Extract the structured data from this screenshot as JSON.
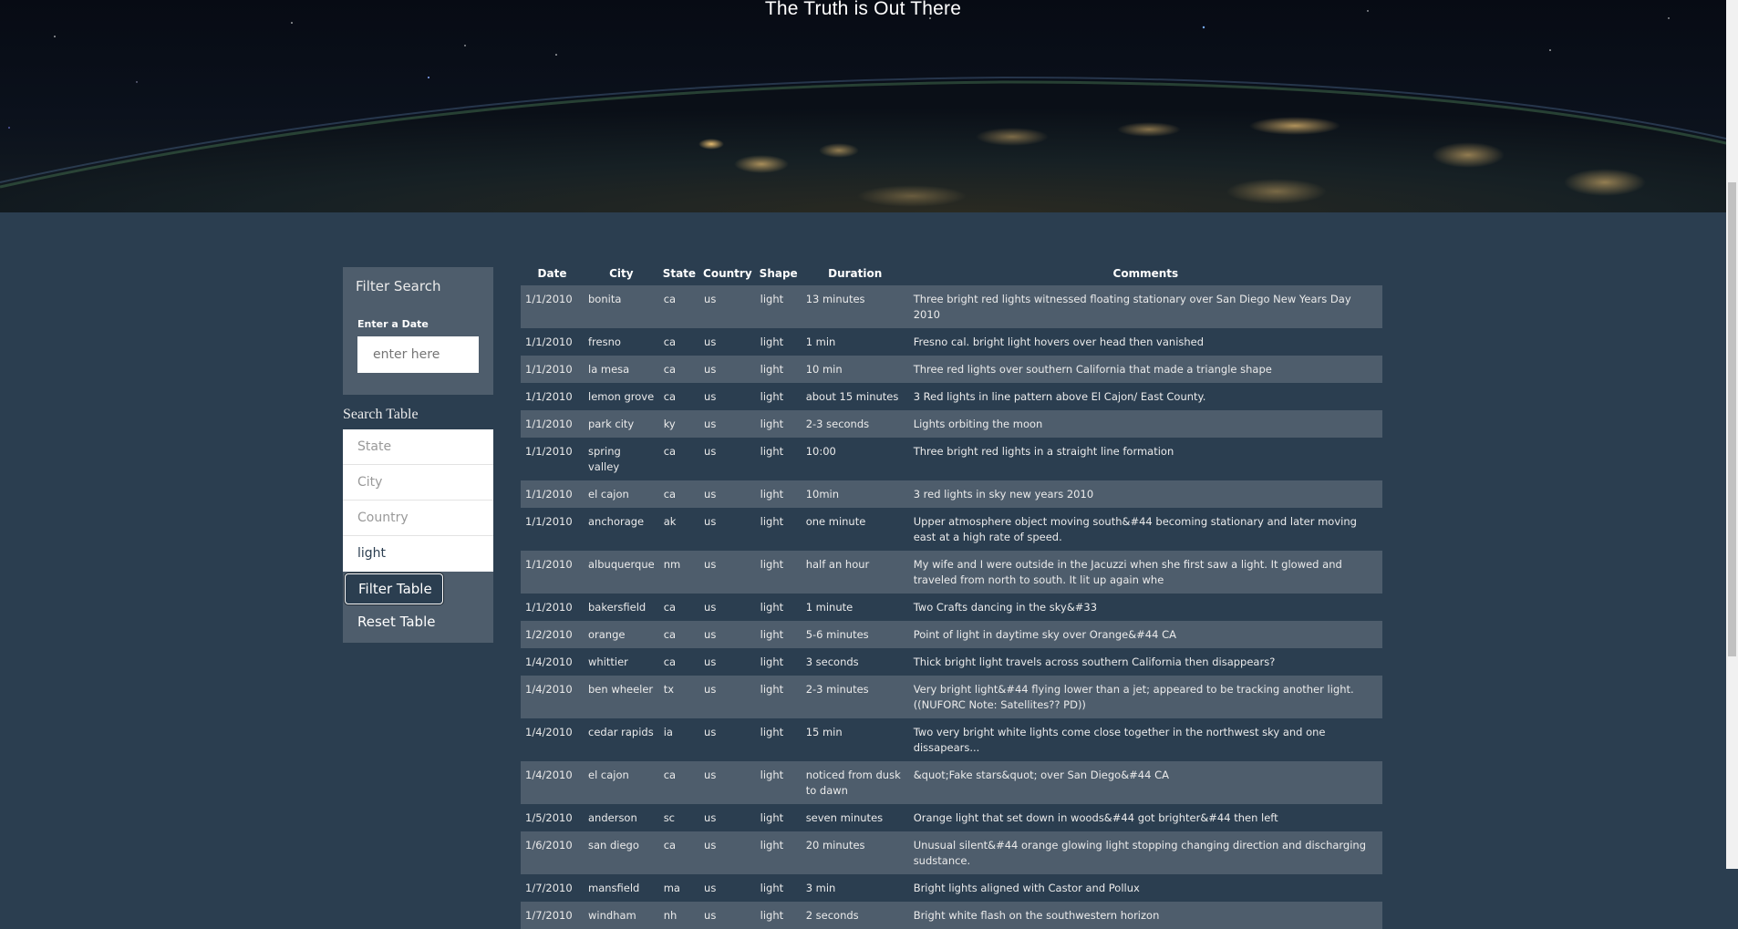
{
  "header": {
    "title": "The Truth is Out There"
  },
  "sidebar": {
    "filter_heading": "Filter Search",
    "date_label": "Enter a Date",
    "date_placeholder": "enter here",
    "search_heading": "Search Table",
    "search_fields": [
      {
        "placeholder": "State",
        "value": ""
      },
      {
        "placeholder": "City",
        "value": ""
      },
      {
        "placeholder": "Country",
        "value": ""
      },
      {
        "placeholder": "",
        "value": "light"
      }
    ],
    "filter_button": "Filter Table",
    "reset_button": "Reset Table"
  },
  "table": {
    "headers": [
      "Date",
      "City",
      "State",
      "Country",
      "Shape",
      "Duration",
      "Comments"
    ],
    "rows": [
      [
        "1/1/2010",
        "bonita",
        "ca",
        "us",
        "light",
        "13 minutes",
        "Three bright red lights witnessed floating stationary over San Diego New Years Day 2010"
      ],
      [
        "1/1/2010",
        "fresno",
        "ca",
        "us",
        "light",
        "1 min",
        "Fresno cal. bright light hovers over head then vanished"
      ],
      [
        "1/1/2010",
        "la mesa",
        "ca",
        "us",
        "light",
        "10 min",
        "Three red lights over southern California that made a triangle shape"
      ],
      [
        "1/1/2010",
        "lemon grove",
        "ca",
        "us",
        "light",
        "about 15 minutes",
        "3 Red lights in line pattern above El Cajon/ East County."
      ],
      [
        "1/1/2010",
        "park city",
        "ky",
        "us",
        "light",
        "2-3 seconds",
        "Lights orbiting the moon"
      ],
      [
        "1/1/2010",
        "spring valley",
        "ca",
        "us",
        "light",
        "10:00",
        "Three bright red lights in a straight line formation"
      ],
      [
        "1/1/2010",
        "el cajon",
        "ca",
        "us",
        "light",
        "10min",
        "3 red lights in sky new years 2010"
      ],
      [
        "1/1/2010",
        "anchorage",
        "ak",
        "us",
        "light",
        "one minute",
        "Upper atmosphere object moving south&#44 becoming stationary and later moving east at a high rate of speed."
      ],
      [
        "1/1/2010",
        "albuquerque",
        "nm",
        "us",
        "light",
        "half an hour",
        "My wife and I were outside in the Jacuzzi when she first saw a light. It glowed and traveled from north to south. It lit up again whe"
      ],
      [
        "1/1/2010",
        "bakersfield",
        "ca",
        "us",
        "light",
        "1 minute",
        "Two Crafts dancing in the sky&#33"
      ],
      [
        "1/2/2010",
        "orange",
        "ca",
        "us",
        "light",
        "5-6 minutes",
        "Point of light in daytime sky over Orange&#44 CA"
      ],
      [
        "1/4/2010",
        "whittier",
        "ca",
        "us",
        "light",
        "3 seconds",
        "Thick bright light travels across southern California then disappears?"
      ],
      [
        "1/4/2010",
        "ben wheeler",
        "tx",
        "us",
        "light",
        "2-3 minutes",
        "Very bright light&#44 flying lower than a jet; appeared to be tracking another light. ((NUFORC Note: Satellites?? PD))"
      ],
      [
        "1/4/2010",
        "cedar rapids",
        "ia",
        "us",
        "light",
        "15 min",
        "Two very bright white lights come close together in the northwest sky and one dissapears..."
      ],
      [
        "1/4/2010",
        "el cajon",
        "ca",
        "us",
        "light",
        "noticed from dusk to dawn",
        "&quot;Fake stars&quot; over San Diego&#44 CA"
      ],
      [
        "1/5/2010",
        "anderson",
        "sc",
        "us",
        "light",
        "seven minutes",
        "Orange light that set down in woods&#44 got brighter&#44 then left"
      ],
      [
        "1/6/2010",
        "san diego",
        "ca",
        "us",
        "light",
        "20 minutes",
        "Unusual silent&#44 orange glowing light stopping changing direction and discharging sudstance."
      ],
      [
        "1/7/2010",
        "mansfield",
        "ma",
        "us",
        "light",
        "3 min",
        "Bright lights aligned with Castor and Pollux"
      ],
      [
        "1/7/2010",
        "windham",
        "nh",
        "us",
        "light",
        "2 seconds",
        "Bright white flash on the southwestern horizon"
      ]
    ]
  }
}
